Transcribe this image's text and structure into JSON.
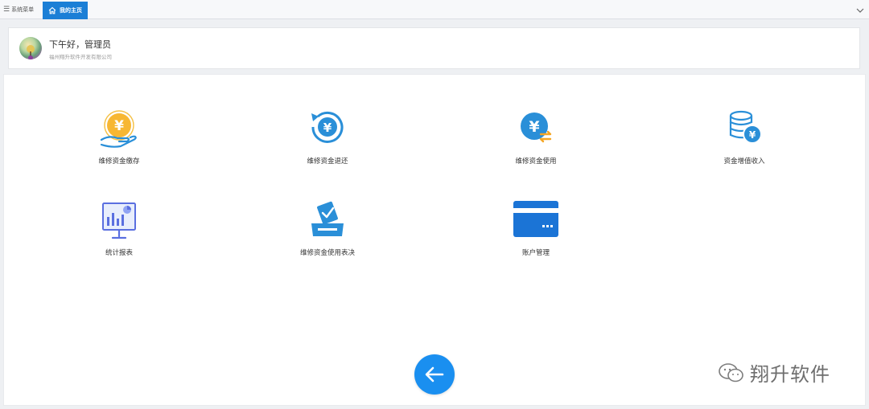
{
  "topbar": {
    "menu_label": "系统菜单",
    "home_tab": "我的主页"
  },
  "welcome": {
    "greeting": "下午好，管理员",
    "company": "福州翔升软件开发有限公司"
  },
  "tiles": [
    {
      "label": "维修资金缴存",
      "icon": "yuan-hand-icon"
    },
    {
      "label": "维修资金退还",
      "icon": "yuan-refund-icon"
    },
    {
      "label": "维修资金使用",
      "icon": "yuan-exchange-icon"
    },
    {
      "label": "资金增值收入",
      "icon": "coin-stack-icon"
    },
    {
      "label": "统计报表",
      "icon": "chart-board-icon"
    },
    {
      "label": "维修资金使用表决",
      "icon": "ballot-box-icon"
    },
    {
      "label": "账户管理",
      "icon": "bank-card-icon"
    }
  ],
  "watermark": {
    "text": "翔升软件"
  },
  "colors": {
    "primary": "#1b7fd6",
    "fab": "#1a8ff0",
    "icon_blue": "#2a8fd8",
    "icon_orange": "#f5a623"
  }
}
